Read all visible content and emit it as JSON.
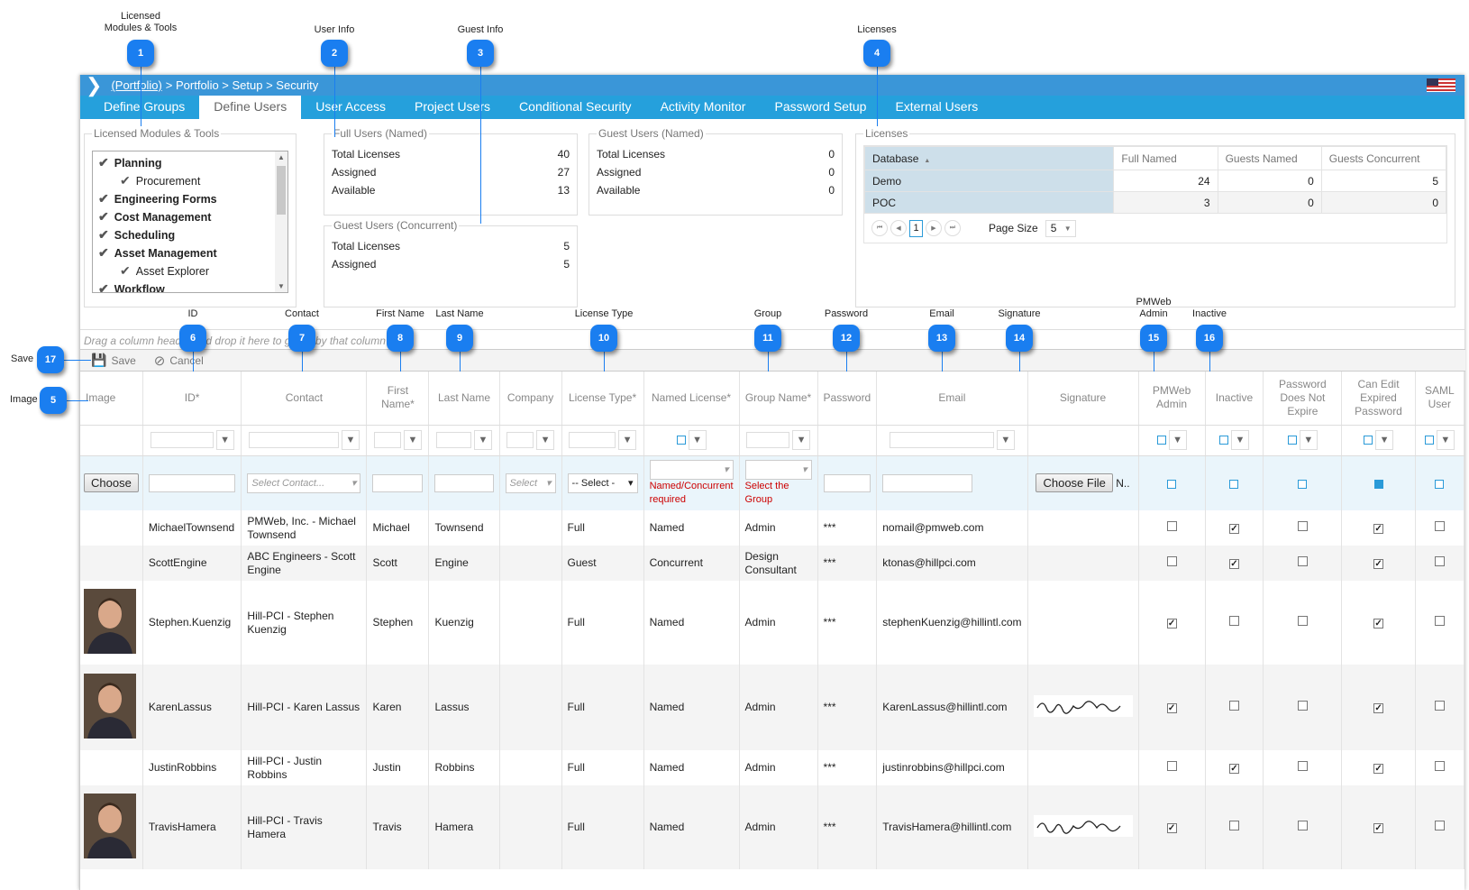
{
  "callouts": {
    "top": [
      {
        "n": "1",
        "label": "Licensed\nModules & Tools"
      },
      {
        "n": "2",
        "label": "User Info"
      },
      {
        "n": "3",
        "label": "Guest Info"
      },
      {
        "n": "4",
        "label": "Licenses"
      }
    ],
    "grid": [
      {
        "n": "6",
        "label": "ID"
      },
      {
        "n": "7",
        "label": "Contact"
      },
      {
        "n": "8",
        "label": "First Name"
      },
      {
        "n": "9",
        "label": "Last Name"
      },
      {
        "n": "10",
        "label": "License Type"
      },
      {
        "n": "11",
        "label": "Group"
      },
      {
        "n": "12",
        "label": "Password"
      },
      {
        "n": "13",
        "label": "Email"
      },
      {
        "n": "14",
        "label": "Signature"
      },
      {
        "n": "15",
        "label": "PMWeb\nAdmin"
      },
      {
        "n": "16",
        "label": "Inactive"
      }
    ],
    "left": [
      {
        "n": "17",
        "label": "Save"
      },
      {
        "n": "5",
        "label": "Image"
      }
    ]
  },
  "breadcrumb": {
    "link": "(Portfolio)",
    "rest": "> Portfolio > Setup > Security"
  },
  "tabs": [
    "Define Groups",
    "Define Users",
    "User Access",
    "Project Users",
    "Conditional Security",
    "Activity Monitor",
    "Password Setup",
    "External Users"
  ],
  "active_tab": "Define Users",
  "modules": {
    "title": "Licensed Modules & Tools",
    "items": [
      {
        "label": "Planning",
        "sub": false
      },
      {
        "label": "Procurement",
        "sub": true
      },
      {
        "label": "Engineering Forms",
        "sub": false
      },
      {
        "label": "Cost Management",
        "sub": false
      },
      {
        "label": "Scheduling",
        "sub": false
      },
      {
        "label": "Asset Management",
        "sub": false
      },
      {
        "label": "Asset Explorer",
        "sub": true
      },
      {
        "label": "Workflow",
        "sub": false
      }
    ]
  },
  "full_users": {
    "title": "Full Users (Named)",
    "rows": [
      {
        "k": "Total Licenses",
        "v": "40"
      },
      {
        "k": "Assigned",
        "v": "27"
      },
      {
        "k": "Available",
        "v": "13"
      }
    ]
  },
  "guest_named": {
    "title": "Guest Users (Named)",
    "rows": [
      {
        "k": "Total Licenses",
        "v": "0"
      },
      {
        "k": "Assigned",
        "v": "0"
      },
      {
        "k": "Available",
        "v": "0"
      }
    ]
  },
  "guest_concurrent": {
    "title": "Guest Users (Concurrent)",
    "rows": [
      {
        "k": "Total Licenses",
        "v": "5"
      },
      {
        "k": "Assigned",
        "v": "5"
      }
    ]
  },
  "licenses": {
    "title": "Licenses",
    "columns": [
      "Database",
      "Full Named",
      "Guests Named",
      "Guests Concurrent"
    ],
    "rows": [
      [
        "Demo",
        "24",
        "0",
        "5"
      ],
      [
        "POC",
        "3",
        "0",
        "0"
      ]
    ],
    "page": "1",
    "page_size_label": "Page Size",
    "page_size": "5"
  },
  "grid": {
    "group_hint": "Drag a column header and drop it here to group by that column",
    "save": "Save",
    "cancel": "Cancel",
    "columns": [
      "Image",
      "ID*",
      "Contact",
      "First Name*",
      "Last Name",
      "Company",
      "License Type*",
      "Named License*",
      "Group Name*",
      "Password",
      "Email",
      "Signature",
      "PMWeb Admin",
      "Inactive",
      "Password Does Not Expire",
      "Can Edit Expired Password",
      "SAML User"
    ],
    "new_row": {
      "choose": "Choose",
      "contact_ph": "Select Contact...",
      "company_ph": "Select",
      "license_sel": "-- Select -",
      "named_err": "Named/Concurrent required",
      "group_err": "Select the Group",
      "file_btn": "Choose File",
      "file_none": "N.."
    },
    "rows": [
      {
        "photo": false,
        "id": "MichaelTownsend",
        "contact": "PMWeb, Inc. - Michael Townsend",
        "first": "Michael",
        "last": "Townsend",
        "company": "",
        "license": "Full",
        "named": "Named",
        "group": "Admin",
        "password": "***",
        "email": "nomail@pmweb.com",
        "signature": false,
        "admin": false,
        "inactive": true,
        "noexpire": false,
        "canedit": true,
        "saml": false
      },
      {
        "photo": false,
        "id": "ScottEngine",
        "contact": "ABC Engineers - Scott Engine",
        "first": "Scott",
        "last": "Engine",
        "company": "",
        "license": "Guest",
        "named": "Concurrent",
        "group": "Design Consultant",
        "password": "***",
        "email": "ktonas@hillpci.com",
        "signature": false,
        "admin": false,
        "inactive": true,
        "noexpire": false,
        "canedit": true,
        "saml": false
      },
      {
        "photo": true,
        "id": "Stephen.Kuenzig",
        "contact": "Hill-PCI - Stephen Kuenzig",
        "first": "Stephen",
        "last": "Kuenzig",
        "company": "",
        "license": "Full",
        "named": "Named",
        "group": "Admin",
        "password": "***",
        "email": "stephenKuenzig@hillintl.com",
        "signature": false,
        "admin": true,
        "inactive": false,
        "noexpire": false,
        "canedit": true,
        "saml": false
      },
      {
        "photo": true,
        "id": "KarenLassus",
        "contact": "Hill-PCI - Karen Lassus",
        "first": "Karen",
        "last": "Lassus",
        "company": "",
        "license": "Full",
        "named": "Named",
        "group": "Admin",
        "password": "***",
        "email": "KarenLassus@hillintl.com",
        "signature": true,
        "admin": true,
        "inactive": false,
        "noexpire": false,
        "canedit": true,
        "saml": false
      },
      {
        "photo": false,
        "id": "JustinRobbins",
        "contact": "Hill-PCI - Justin Robbins",
        "first": "Justin",
        "last": "Robbins",
        "company": "",
        "license": "Full",
        "named": "Named",
        "group": "Admin",
        "password": "***",
        "email": "justinrobbins@hillpci.com",
        "signature": false,
        "admin": false,
        "inactive": true,
        "noexpire": false,
        "canedit": true,
        "saml": false
      },
      {
        "photo": true,
        "id": "TravisHamera",
        "contact": "Hill-PCI - Travis Hamera",
        "first": "Travis",
        "last": "Hamera",
        "company": "",
        "license": "Full",
        "named": "Named",
        "group": "Admin",
        "password": "***",
        "email": "TravisHamera@hillintl.com",
        "signature": true,
        "admin": true,
        "inactive": false,
        "noexpire": false,
        "canedit": true,
        "saml": false
      }
    ]
  },
  "colors": {
    "accent": "#1a7ef0",
    "breadcrumb_bg": "#3a96d8",
    "tab_bg": "#25a0dc",
    "new_row_bg": "#eaf5fb",
    "error": "#cc0000"
  }
}
